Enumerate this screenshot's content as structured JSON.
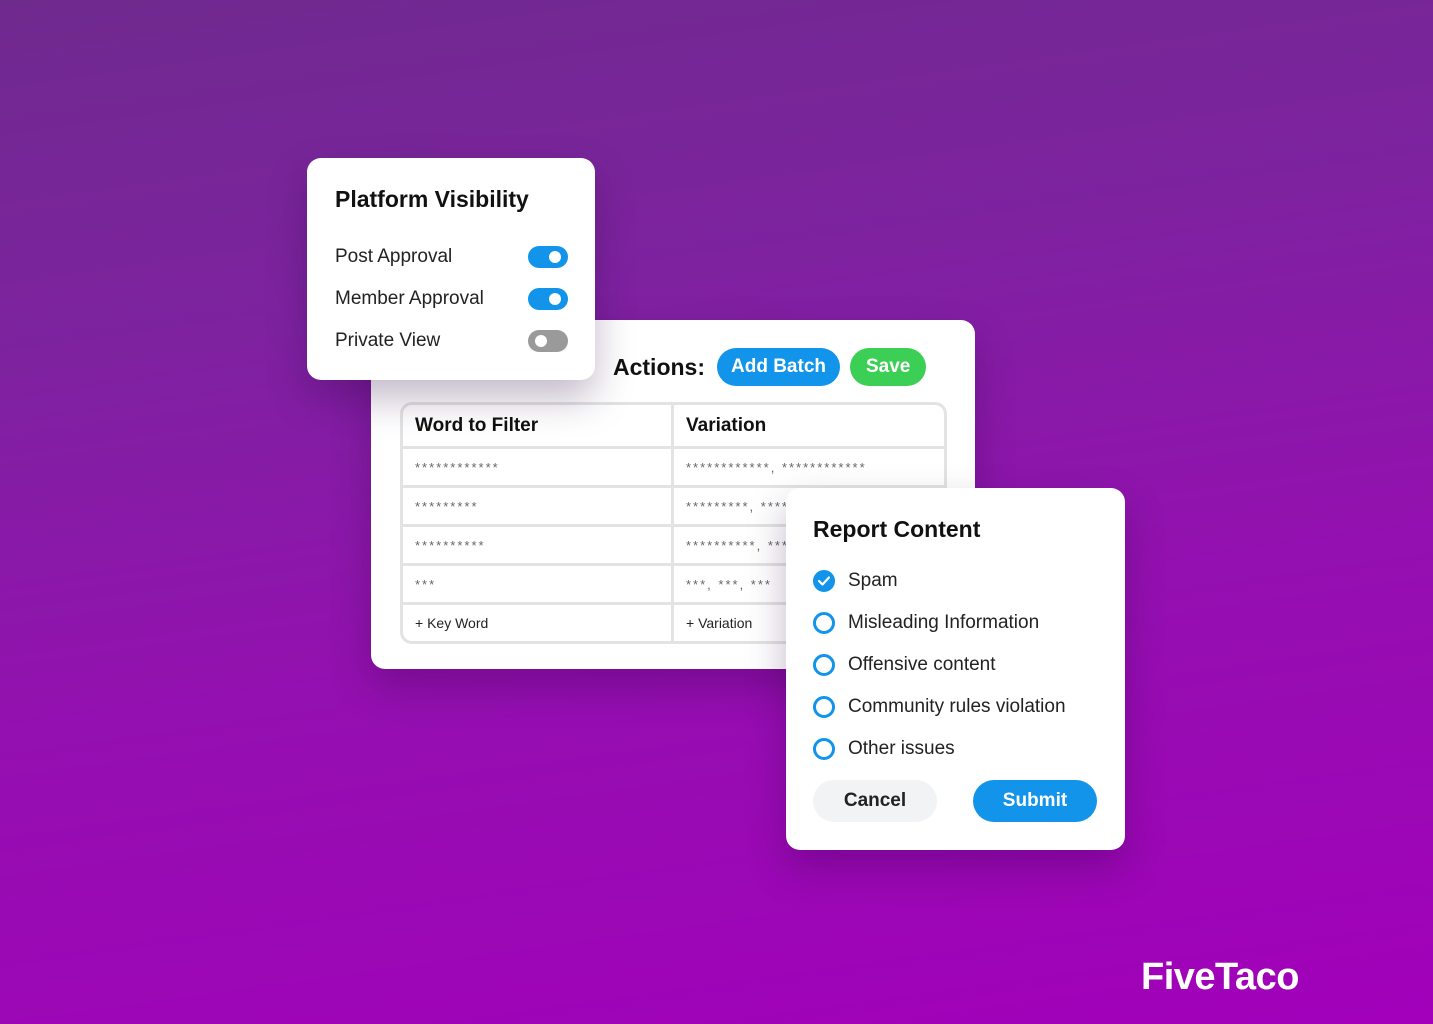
{
  "colors": {
    "background_top": "#6f2a8e",
    "background_bottom": "#a200ba",
    "accent_blue": "#1294ea",
    "accent_green": "#3ccf55",
    "toggle_off": "#9a9a9a"
  },
  "platform_visibility": {
    "title": "Platform Visibility",
    "toggles": [
      {
        "label": "Post Approval",
        "state": "on"
      },
      {
        "label": "Member Approval",
        "state": "on"
      },
      {
        "label": "Private View",
        "state": "off"
      }
    ]
  },
  "filter_panel": {
    "actions_label": "Actions:",
    "add_batch_label": "Add Batch",
    "save_label": "Save",
    "columns": [
      "Word to Filter",
      "Variation"
    ],
    "rows": [
      {
        "word": "************",
        "variation": "************, ************"
      },
      {
        "word": "*********",
        "variation": "*********, *********"
      },
      {
        "word": "**********",
        "variation": "**********, **********"
      },
      {
        "word": "***",
        "variation": "***, ***, ***"
      }
    ],
    "add_keyword_label": "+ Key Word",
    "add_variation_label": "+ Variation"
  },
  "report_content": {
    "title": "Report Content",
    "options": [
      {
        "label": "Spam",
        "checked": true
      },
      {
        "label": "Misleading Information",
        "checked": false
      },
      {
        "label": "Offensive content",
        "checked": false
      },
      {
        "label": "Community rules violation",
        "checked": false
      },
      {
        "label": "Other issues",
        "checked": false
      }
    ],
    "cancel_label": "Cancel",
    "submit_label": "Submit"
  },
  "brand": {
    "name": "FiveTaco"
  }
}
